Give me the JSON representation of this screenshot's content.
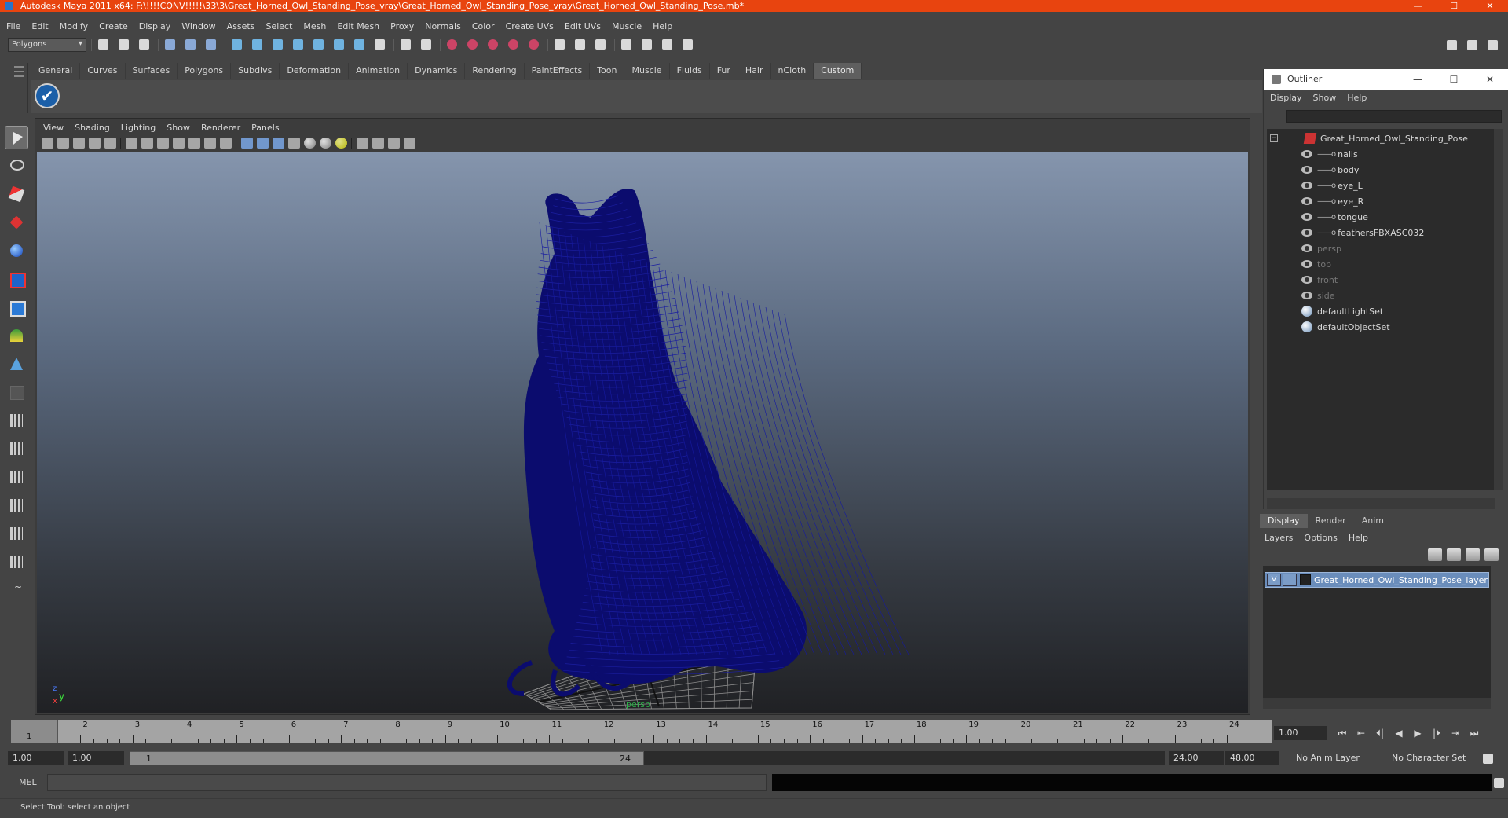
{
  "window": {
    "title": "Autodesk Maya 2011 x64: F:\\!!!!CONV!!!!!\\33\\3\\Great_Horned_Owl_Standing_Pose_vray\\Great_Horned_Owl_Standing_Pose_vray\\Great_Horned_Owl_Standing_Pose.mb*",
    "minimize": "—",
    "maximize": "☐",
    "close": "✕"
  },
  "menubar": [
    "File",
    "Edit",
    "Modify",
    "Create",
    "Display",
    "Window",
    "Assets",
    "Select",
    "Mesh",
    "Edit Mesh",
    "Proxy",
    "Normals",
    "Color",
    "Create UVs",
    "Edit UVs",
    "Muscle",
    "Help"
  ],
  "statusline": {
    "mode": "Polygons"
  },
  "shelf": {
    "tabs": [
      "General",
      "Curves",
      "Surfaces",
      "Polygons",
      "Subdivs",
      "Deformation",
      "Animation",
      "Dynamics",
      "Rendering",
      "PaintEffects",
      "Toon",
      "Muscle",
      "Fluids",
      "Fur",
      "Hair",
      "nCloth",
      "Custom"
    ],
    "active_tab": "Custom",
    "check_glyph": "✔"
  },
  "viewport": {
    "menu": [
      "View",
      "Shading",
      "Lighting",
      "Show",
      "Renderer",
      "Panels"
    ],
    "camera": "persp",
    "axis_y": "y",
    "axis_z": "z",
    "axis_x": "x",
    "wire_color": "#0b0c6e"
  },
  "outliner": {
    "title": "Outliner",
    "menu": [
      "Display",
      "Show",
      "Help"
    ],
    "root": "Great_Horned_Owl_Standing_Pose",
    "children": [
      "nails",
      "body",
      "eye_L",
      "eye_R",
      "tongue",
      "feathersFBXASC032"
    ],
    "cameras": [
      "persp",
      "top",
      "front",
      "side"
    ],
    "sets": [
      "defaultLightSet",
      "defaultObjectSet"
    ],
    "expand_glyph": "−"
  },
  "layer_editor": {
    "tabs": [
      "Display",
      "Render",
      "Anim"
    ],
    "active_tab": "Display",
    "menu": [
      "Layers",
      "Options",
      "Help"
    ],
    "layer": {
      "visible": "V",
      "name": "Great_Horned_Owl_Standing_Pose_layer"
    }
  },
  "timeline": {
    "ticks": [
      1,
      2,
      3,
      4,
      5,
      6,
      7,
      8,
      9,
      10,
      11,
      12,
      13,
      14,
      15,
      16,
      17,
      18,
      19,
      20,
      21,
      22,
      23,
      24
    ],
    "current_frame_label": "1",
    "current_frame": "1.00",
    "playback": [
      "⏮",
      "⇤",
      "⏴|",
      "◀",
      "▶",
      "|⏵",
      "⇥",
      "⏭"
    ]
  },
  "range": {
    "start_time": "1.00",
    "playback_start": "1.00",
    "range_start_label": "1",
    "range_end_label": "24",
    "playback_end": "24.00",
    "end_time": "48.00",
    "anim_layer": "No Anim Layer",
    "character_set": "No Character Set"
  },
  "command": {
    "label": "MEL"
  },
  "help": {
    "text": "Select Tool: select an object"
  }
}
